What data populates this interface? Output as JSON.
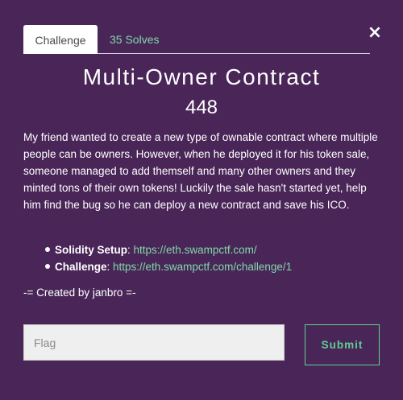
{
  "modal": {
    "close_glyph": "×",
    "tabs": [
      {
        "label": "Challenge"
      },
      {
        "label": "35 Solves"
      }
    ],
    "title": "Multi-Owner Contract",
    "value": "448",
    "description": "My friend wanted to create a new type of ownable contract where multiple people can be owners. However, when he deployed it for his token sale, someone managed to add themself and many other owners and they minted tons of their own tokens! Luckily the sale hasn't started yet, help him find the bug so he can deploy a new contract and save his ICO.",
    "links": [
      {
        "label": "Solidity Setup",
        "separator": ": ",
        "url": "https://eth.swampctf.com/"
      },
      {
        "label": "Challenge",
        "separator": ": ",
        "url": "https://eth.swampctf.com/challenge/1"
      }
    ],
    "credit": "-= Created by janbro =-",
    "flag_placeholder": "Flag",
    "submit_label": "Submit"
  },
  "colors": {
    "modal_background": "#4a2658",
    "accent_green": "#5fcf92",
    "link_green": "#7fd9a8"
  }
}
